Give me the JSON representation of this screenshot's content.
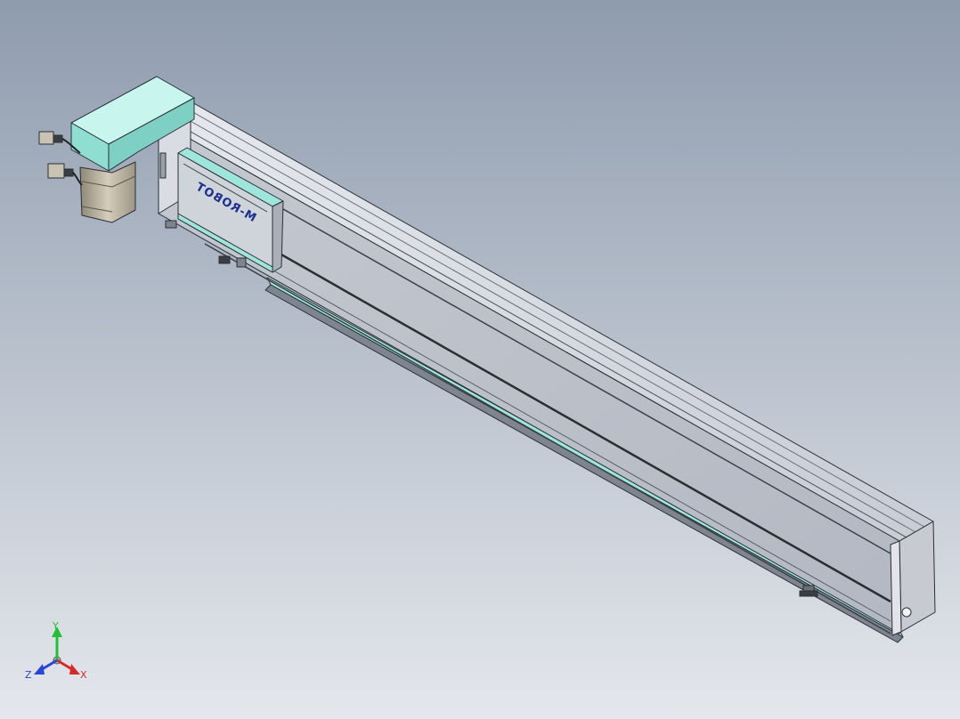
{
  "viewport": {
    "background_top": "#8f9cae",
    "background_bottom": "#e4e7ec"
  },
  "model": {
    "carriage_label": "M-ROBOT",
    "label_color": "#1b2f8f",
    "body_color": "#c9ccd3",
    "accent_color": "#9ee6dc",
    "motor_color": "#b8b0a0"
  },
  "triad": {
    "x_label": "X",
    "y_label": "Y",
    "z_label": "Z",
    "x_color": "#d42a2a",
    "y_color": "#22c03a",
    "z_color": "#2a44d4"
  }
}
